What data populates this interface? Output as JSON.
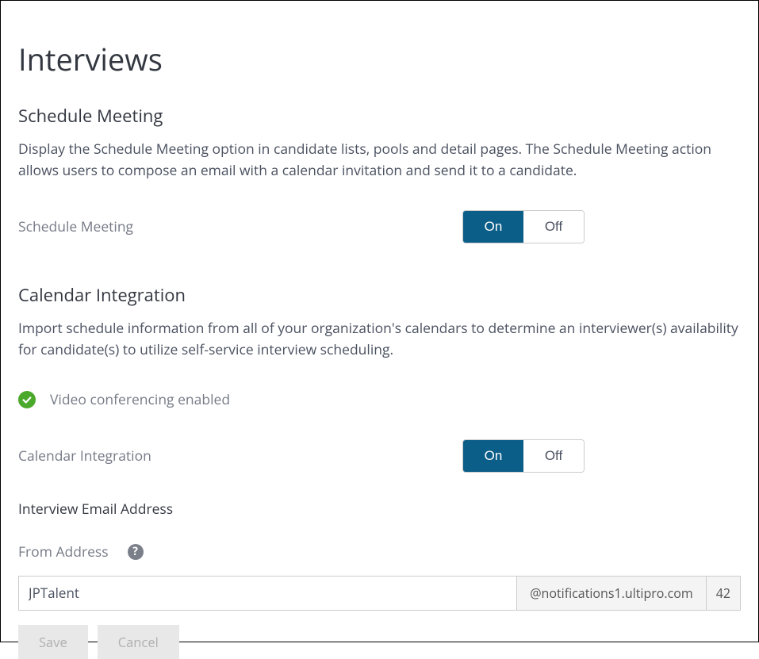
{
  "page": {
    "title": "Interviews"
  },
  "schedule_meeting": {
    "heading": "Schedule Meeting",
    "description": "Display the Schedule Meeting option in candidate lists, pools and detail pages. The Schedule Meeting action allows users to compose an email with a calendar invitation and send it to a candidate.",
    "label": "Schedule Meeting",
    "on_label": "On",
    "off_label": "Off",
    "value": "On"
  },
  "calendar_integration": {
    "heading": "Calendar Integration",
    "description": "Import schedule information from all of your organization's calendars to determine an interviewer(s) availability for candidate(s) to utilize self-service interview scheduling.",
    "status_text": "Video conferencing enabled",
    "label": "Calendar Integration",
    "on_label": "On",
    "off_label": "Off",
    "value": "On"
  },
  "email": {
    "heading": "Interview Email Address",
    "from_label": "From Address",
    "value": "JPTalent",
    "domain": "@notifications1.ultipro.com",
    "remaining": "42"
  },
  "actions": {
    "save": "Save",
    "cancel": "Cancel"
  }
}
